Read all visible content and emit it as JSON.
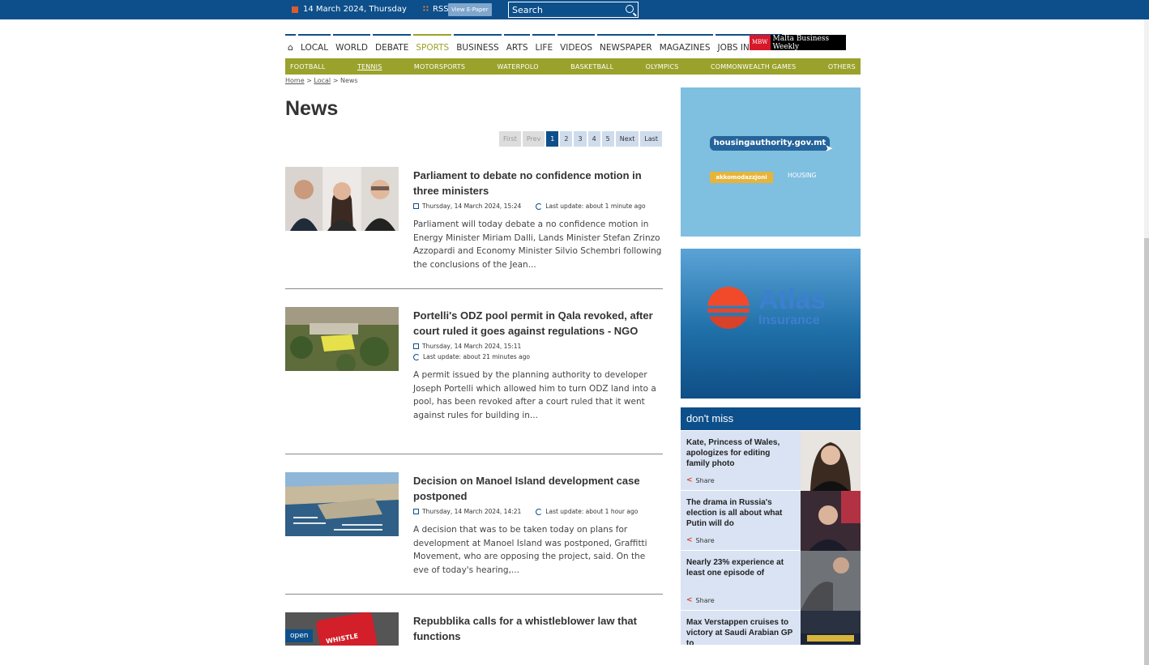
{
  "topbar": {
    "date": "14 March 2024, Thursday",
    "rss": "RSS",
    "epaper": "View E-Paper",
    "search_placeholder": "Search"
  },
  "nav": {
    "items": [
      "LOCAL",
      "WORLD",
      "DEBATE",
      "SPORTS",
      "BUSINESS",
      "ARTS",
      "LIFE",
      "VIDEOS",
      "NEWSPAPER",
      "MAGAZINES",
      "JOBS IN MALTA"
    ],
    "partner_badge": "MBW",
    "partner_name": "Malta Business Weekly"
  },
  "subnav": [
    "FOOTBALL",
    "TENNIS",
    "MOTORSPORTS",
    "WATERPOLO",
    "BASKETBALL",
    "OLYMPICS",
    "COMMONWEALTH GAMES",
    "OTHERS"
  ],
  "breadcrumb": {
    "home": "Home",
    "sep1": ">",
    "local": "Local",
    "sep2": ">",
    "current": "News"
  },
  "page_title": "News",
  "pager": [
    "First",
    "Prev",
    "1",
    "2",
    "3",
    "4",
    "5",
    "Next",
    "Last"
  ],
  "articles": [
    {
      "title": "Parliament to debate no confidence motion in three ministers",
      "date": "Thursday, 14 March 2024, 15:24",
      "update": "Last update: about 1 minute ago",
      "summary": "Parliament will today debate a no confidence motion in Energy Minister Miriam Dalli, Lands Minister Stefan Zrinzo Azzopardi and Economy Minister Silvio Schembri following the conclusions of the Jean..."
    },
    {
      "title": "Portelli's ODZ pool permit in Qala revoked, after court ruled it goes against regulations - NGO",
      "date": "Thursday, 14 March 2024, 15:11",
      "update": "Last update: about 21 minutes ago",
      "summary": "A permit issued by the planning authority to developer Joseph Portelli which allowed him to turn ODZ land into a pool, has been revoked after a court ruled that it went against rules for building in..."
    },
    {
      "title": "Decision on Manoel Island development case postponed",
      "date": "Thursday, 14 March 2024, 14:21",
      "update": "Last update: about 1 hour ago",
      "summary": "A decision that was to be taken today on plans for development at Manoel Island was postponed, Graffitti Movement, who are opposing the project, said. On the eve of today's hearing,..."
    },
    {
      "title": "Repubblika calls for a whistleblower law that functions",
      "badge": "open",
      "img_text": "WHISTLE"
    }
  ],
  "ads": {
    "housing_url": "housingauthority.gov.mt",
    "housing_btn": "akkomodazzjoni",
    "housing_logo": "HOUSING",
    "atlas": "Atlas",
    "atlas_sub": "Insurance"
  },
  "dont_miss": {
    "title": "don't miss",
    "share_label": "Share",
    "items": [
      {
        "title": "Kate, Princess of Wales, apologizes for editing family photo"
      },
      {
        "title": "The drama in Russia's election is all about what Putin will do"
      },
      {
        "title": "Nearly 23% experience at least one episode of"
      },
      {
        "title": "Max Verstappen cruises to victory at Saudi Arabian GP to"
      }
    ]
  },
  "colors": {
    "brand_blue": "#0d4f8b",
    "sports_green": "#9aa22b",
    "accent_red": "#d8182a"
  }
}
